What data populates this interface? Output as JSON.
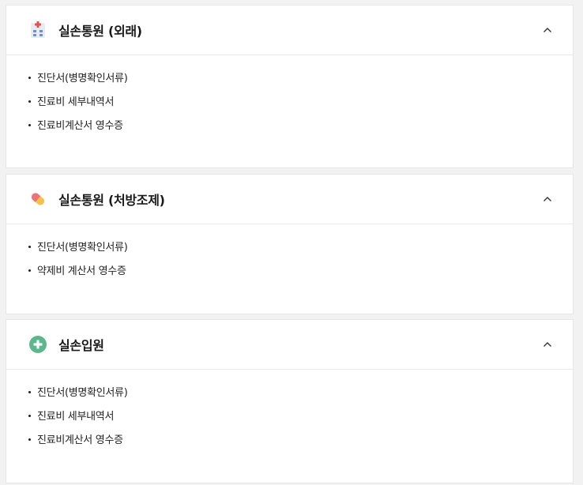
{
  "sections": [
    {
      "title": "실손통원 (외래)",
      "icon": "clinic-building-icon",
      "items": [
        "진단서(병명확인서류)",
        "진료비 세부내역서",
        "진료비계산서 영수증"
      ]
    },
    {
      "title": "실손통원 (처방조제)",
      "icon": "pill-capsule-icon",
      "items": [
        "진단서(병명확인서류)",
        "약제비 계산서 영수증"
      ]
    },
    {
      "title": "실손입원",
      "icon": "green-plus-circle-icon",
      "items": [
        "진단서(병명확인서류)",
        "진료비 세부내역서",
        "진료비계산서 영수증"
      ]
    }
  ],
  "colors": {
    "page_bg": "#f2f2f2",
    "card_bg": "#ffffff",
    "pill_red": "#e8737a",
    "pill_yellow": "#f5c24c",
    "plus_green": "#5cb88c",
    "building_red": "#e6524f",
    "building_blue": "#6f8fc7"
  }
}
